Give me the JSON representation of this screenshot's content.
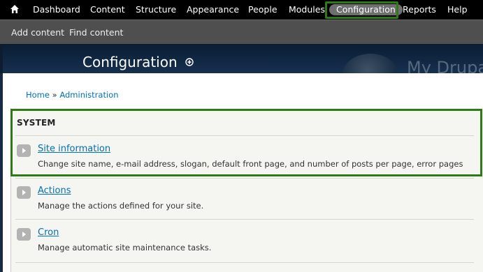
{
  "toolbar": {
    "home_icon": "home-icon",
    "items": [
      {
        "label": "Dashboard"
      },
      {
        "label": "Content"
      },
      {
        "label": "Structure"
      },
      {
        "label": "Appearance"
      },
      {
        "label": "People"
      },
      {
        "label": "Modules"
      },
      {
        "label": "Configuration",
        "active": true
      },
      {
        "label": "Reports"
      },
      {
        "label": "Help"
      }
    ]
  },
  "shortcuts": {
    "items": [
      {
        "label": "Add content"
      },
      {
        "label": "Find content"
      }
    ]
  },
  "header": {
    "page_title": "Configuration",
    "add_shortcut_icon": "plus-circle-icon",
    "site_name": "My Drupal"
  },
  "breadcrumb": {
    "home": "Home",
    "separator": "»",
    "admin": "Administration"
  },
  "system": {
    "title": "SYSTEM",
    "items": [
      {
        "title": "Site information",
        "description": "Change site name, e-mail address, slogan, default front page, and number of posts per page, error pages"
      },
      {
        "title": "Actions",
        "description": "Manage the actions defined for your site."
      },
      {
        "title": "Cron",
        "description": "Manage automatic site maintenance tasks."
      }
    ]
  },
  "colors": {
    "toolbar_bg": "#000000",
    "shortcuts_bg": "#4f4f4f",
    "header_bg": "#0a1d33",
    "link": "#0071b3",
    "highlight": "#2e7a17"
  }
}
